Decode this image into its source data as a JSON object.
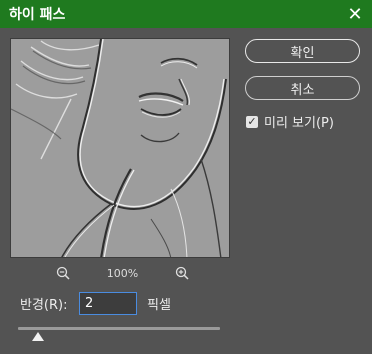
{
  "dialog": {
    "title": "하이 패스",
    "close_icon": "close-icon",
    "ok_label": "확인",
    "cancel_label": "취소",
    "preview_label": "미리 보기(P)",
    "preview_checked": true,
    "zoom": {
      "value": "100%",
      "zoom_out_icon": "zoom-out-icon",
      "zoom_in_icon": "zoom-in-icon"
    },
    "radius": {
      "label": "반경(R):",
      "value": "2",
      "unit": "픽셀",
      "slider_fraction": 0.1
    },
    "colors": {
      "titlebar": "#1f7a1f",
      "background": "#535353",
      "input_border": "#4a8ce0"
    }
  }
}
